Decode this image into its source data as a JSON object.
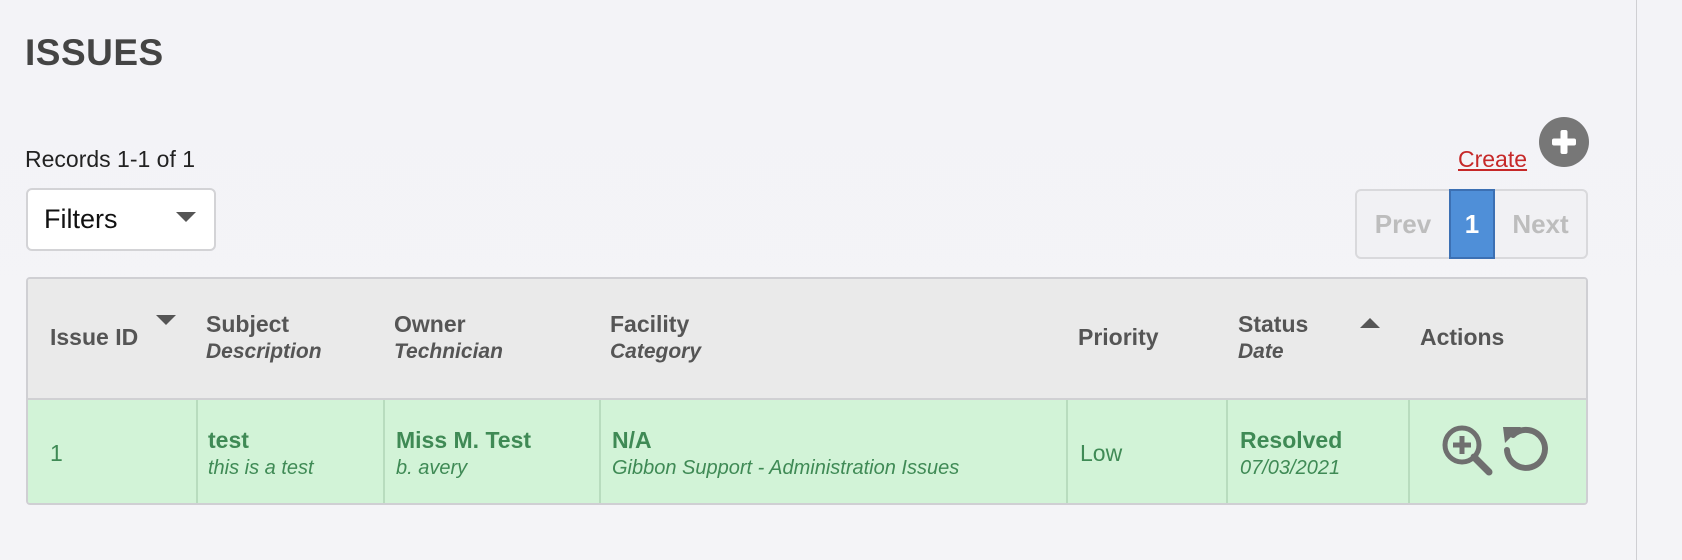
{
  "page": {
    "title": "ISSUES"
  },
  "toolbar": {
    "records_text": "Records 1-1 of 1",
    "filters_label": "Filters",
    "create_label": "Create",
    "add_icon": "plus-circle-icon"
  },
  "pagination": {
    "prev_label": "Prev",
    "current_page": "1",
    "next_label": "Next"
  },
  "table": {
    "headers": [
      {
        "main": "Issue ID",
        "sub": "",
        "sort": "descending"
      },
      {
        "main": "Subject",
        "sub": "Description"
      },
      {
        "main": "Owner",
        "sub": "Technician"
      },
      {
        "main": "Facility",
        "sub": "Category"
      },
      {
        "main": "Priority",
        "sub": ""
      },
      {
        "main": "Status",
        "sub": "Date",
        "sort": "ascending"
      },
      {
        "main": "Actions",
        "sub": ""
      }
    ],
    "rows": [
      {
        "issue_id": "1",
        "subject": "test",
        "description": "this is a test",
        "owner": "Miss M. Test",
        "technician": "b. avery",
        "facility": "N/A",
        "category": "Gibbon Support - Administration Issues",
        "priority": "Low",
        "status": "Resolved",
        "date": "07/03/2021",
        "actions": [
          "zoom-in-icon",
          "reopen-icon"
        ]
      }
    ]
  },
  "colors": {
    "row_highlight": "#d2f3d7",
    "row_text": "#3f8a55",
    "create_link": "#c62828",
    "pager_active": "#4f8fd8",
    "header_bg": "#eaeaea"
  }
}
